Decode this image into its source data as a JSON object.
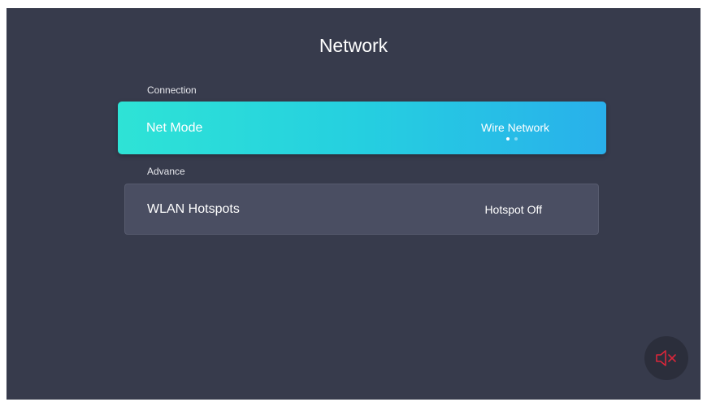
{
  "page": {
    "title": "Network"
  },
  "sections": {
    "connection_label": "Connection",
    "advance_label": "Advance"
  },
  "net_mode": {
    "label": "Net Mode",
    "value": "Wire Network",
    "option_count": 2,
    "selected_option_index": 0
  },
  "wlan_hotspots": {
    "label": "WLAN Hotspots",
    "value": "Hotspot Off"
  },
  "mute_indicator": {
    "icon": "speaker-muted-icon",
    "color": "#d9263a"
  },
  "colors": {
    "background": "#373b4c",
    "focus_gradient_start": "#2ee3d6",
    "focus_gradient_end": "#29b0eb",
    "row_background": "#4a4e62"
  }
}
